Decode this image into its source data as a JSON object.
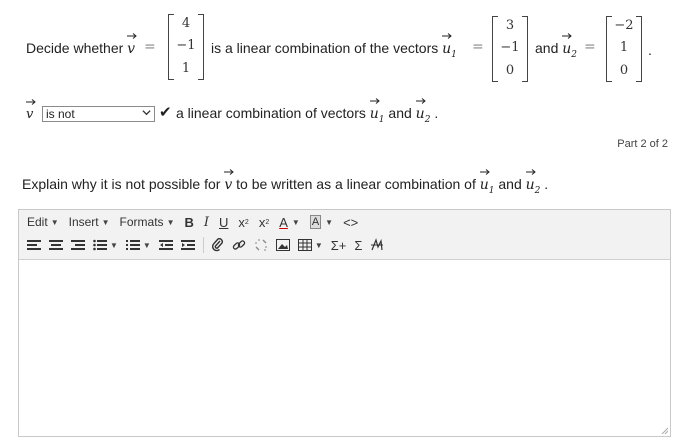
{
  "question": {
    "decide_prefix": "Decide whether",
    "v_symbol": "v",
    "equals": "=",
    "is_linear_combo_text": "is a linear combination of the vectors",
    "u1_symbol": "u",
    "u1_sub": "1",
    "and_text": "and",
    "u2_symbol": "u",
    "u2_sub": "2",
    "period": ".",
    "v_vector": [
      "4",
      "−1",
      "1"
    ],
    "u1_vector": [
      "3",
      "−1",
      "0"
    ],
    "u2_vector": [
      "−2",
      "1",
      "0"
    ]
  },
  "answer_row": {
    "v_symbol": "v",
    "dropdown_value": "is not",
    "check_mark": "✔",
    "suffix_text": "a linear combination of vectors",
    "u1": "u",
    "u1_sub": "1",
    "and_text": "and",
    "u2": "u",
    "u2_sub": "2",
    "period": "."
  },
  "part_label": "Part 2 of 2",
  "explain": {
    "prefix": "Explain why it is not possible for",
    "v_symbol": "v",
    "middle": "to be written as a linear combination of",
    "u1": "u",
    "u1_sub": "1",
    "and_text": "and",
    "u2": "u",
    "u2_sub": "2",
    "period": "."
  },
  "editor": {
    "menus": [
      "Edit",
      "Insert",
      "Formats"
    ],
    "format_buttons": {
      "bold": "B",
      "italic": "I",
      "underline": "U",
      "subscript": "x",
      "superscript": "x",
      "font_color": "A",
      "bg_color": "A",
      "code": "<>"
    },
    "math_buttons": {
      "sum_plus": "Σ+",
      "sum": "Σ"
    }
  }
}
